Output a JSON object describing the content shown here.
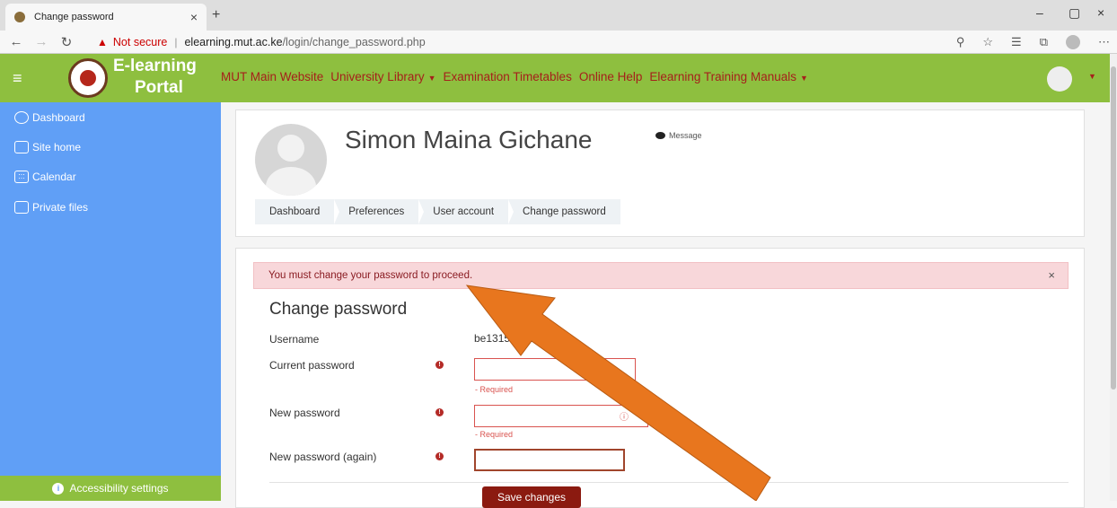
{
  "browser": {
    "tab_title": "Change password",
    "new_tab": "+",
    "tab_close": "×",
    "win_min": "–",
    "win_max": "▢",
    "win_close": "×",
    "not_secure": "Not secure",
    "url_host": "elearning.mut.ac.ke",
    "url_path": "/login/change_password.php"
  },
  "header": {
    "brand_line1": "E-learning",
    "brand_line2": "Portal",
    "nav": [
      {
        "label": "MUT Main Website"
      },
      {
        "label": "University Library",
        "dropdown": true
      },
      {
        "label": "Examination Timetables"
      },
      {
        "label": "Online Help"
      },
      {
        "label": "Elearning Training Manuals",
        "dropdown": true
      }
    ]
  },
  "sidebar": {
    "items": [
      {
        "label": "Dashboard",
        "icon": "dashboard-icon"
      },
      {
        "label": "Site home",
        "icon": "home-icon"
      },
      {
        "label": "Calendar",
        "icon": "calendar-icon"
      },
      {
        "label": "Private files",
        "icon": "files-icon"
      }
    ],
    "accessibility": "Accessibility settings"
  },
  "profile": {
    "name": "Simon Maina Gichane",
    "message_label": "Message"
  },
  "breadcrumb": [
    "Dashboard",
    "Preferences",
    "User account",
    "Change password"
  ],
  "alert": {
    "text": "You must change your password to proceed.",
    "close": "×"
  },
  "form": {
    "title": "Change password",
    "username_label": "Username",
    "username_value": "be131504220",
    "current_label": "Current password",
    "new_label": "New password",
    "again_label": "New password (again)",
    "required_text": "- Required",
    "save_label": "Save changes"
  },
  "colors": {
    "header": "#8ebf3f",
    "sidebar": "#609ff6",
    "brand_red": "#a5201b",
    "arrow": "#e8761e"
  }
}
